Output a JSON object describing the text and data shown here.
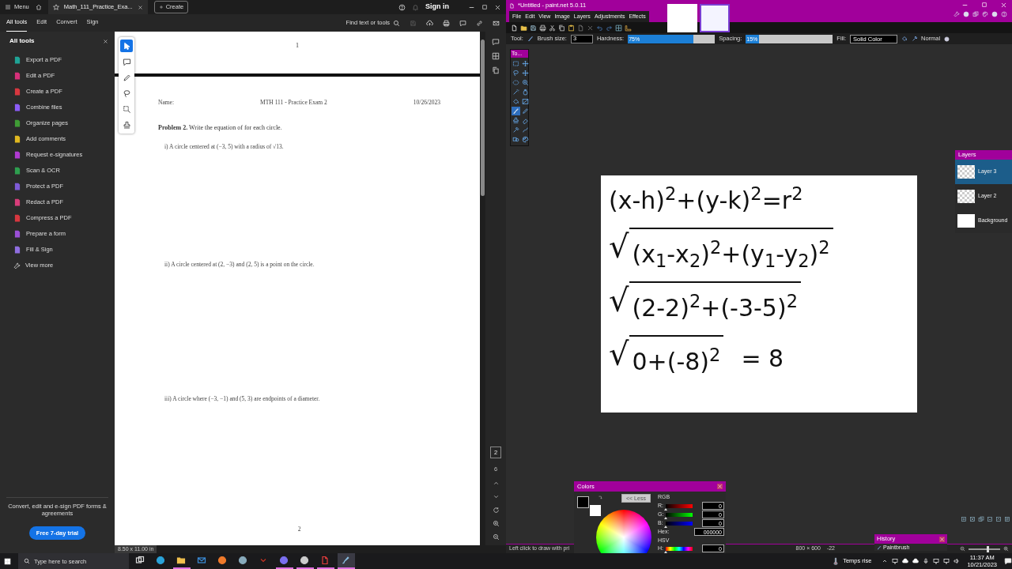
{
  "acrobat": {
    "title_bar": {
      "menu": "Menu",
      "tab_title": "Math_111_Practice_Exa...",
      "create": "Create",
      "sign_in": "Sign in"
    },
    "toolbar_tabs": [
      {
        "label": "All tools",
        "selected": true
      },
      {
        "label": "Edit",
        "selected": false
      },
      {
        "label": "Convert",
        "selected": false
      },
      {
        "label": "Sign",
        "selected": false
      }
    ],
    "find": "Find text or tools",
    "sidebar": {
      "title": "All tools",
      "items": [
        {
          "label": "Export a PDF",
          "kind": "tool",
          "color": "#1fa396"
        },
        {
          "label": "Edit a PDF",
          "kind": "tool",
          "color": "#d6307a"
        },
        {
          "label": "Create a PDF",
          "kind": "tool",
          "color": "#d7373f"
        },
        {
          "label": "Combine files",
          "kind": "tool",
          "color": "#8b5cf6"
        },
        {
          "label": "Organize pages",
          "kind": "tool",
          "color": "#3f9c35"
        },
        {
          "label": "Add comments",
          "kind": "tool",
          "color": "#e0b820"
        },
        {
          "label": "Request e-signatures",
          "kind": "tool",
          "color": "#b03ad1"
        },
        {
          "label": "Scan & OCR",
          "kind": "tool",
          "color": "#2e9e4f"
        },
        {
          "label": "Protect a PDF",
          "kind": "tool",
          "color": "#7e5bd6"
        },
        {
          "label": "Redact a PDF",
          "kind": "tool",
          "color": "#d83d7a"
        },
        {
          "label": "Compress a PDF",
          "kind": "tool",
          "color": "#d7373f"
        },
        {
          "label": "Prepare a form",
          "kind": "tool",
          "color": "#9a4fd6"
        },
        {
          "label": "Fill & Sign",
          "kind": "tool",
          "color": "#8f6ee0"
        },
        {
          "label": "View more",
          "kind": "more"
        }
      ],
      "promo": "Convert, edit and e-sign PDF forms & agreements",
      "trial_button": "Free 7-day trial"
    },
    "doc_tools": [
      {
        "selected": true
      },
      {
        "selected": false
      },
      {
        "selected": false
      },
      {
        "selected": false
      },
      {
        "selected": false
      },
      {
        "selected": false
      }
    ],
    "previous_page": {
      "number": "1"
    },
    "page": {
      "name": "Name:",
      "course": "MTH 111 - Practice Exam 2",
      "date": "10/26/2023",
      "problem": "**Problem 2.** Write the equation of for each circle.",
      "questions": [
        "i) A circle centered at (−3, 5) with a radius of √13.",
        "ii) A circle centered at (2, −3) and (2, 5) is a point on the circle.",
        "iii) A circle where (−3, −1) and (5, 3) are endpoints of a diameter."
      ],
      "number": "2"
    },
    "navigation": {
      "current_page": "2",
      "page_count": "6"
    },
    "page_size": "8.50 x 11.00 in"
  },
  "paintnet": {
    "title": "*Untitled - paint.net 5.0.11",
    "menu": [
      "File",
      "Edit",
      "View",
      "Image",
      "Layers",
      "Adjustments",
      "Effects"
    ],
    "images": [
      {
        "selected": false
      },
      {
        "selected": true
      }
    ],
    "options": {
      "tool_label": "Tool:",
      "brush_size_label": "Brush size:",
      "brush_size": "3",
      "hardness_label": "Hardness:",
      "hardness": {
        "reading": "75%",
        "level": 0.75
      },
      "spacing_label": "Spacing:",
      "spacing": {
        "reading": "15%",
        "level": 0.15
      },
      "fill_label": "Fill:",
      "fill": "Solid Color",
      "blend_mode": "Normal"
    },
    "tools_window": {
      "title": "To...",
      "tools": [
        {
          "selected": false
        },
        {
          "selected": false
        },
        {
          "selected": false
        },
        {
          "selected": false
        },
        {
          "selected": false
        },
        {
          "selected": false
        },
        {
          "selected": false
        },
        {
          "selected": false
        },
        {
          "selected": false
        },
        {
          "selected": false
        },
        {
          "selected": true
        },
        {
          "selected": false
        },
        {
          "selected": false
        },
        {
          "selected": false
        },
        {
          "selected": false
        },
        {
          "selected": false
        },
        {
          "selected": false
        },
        {
          "selected": false
        }
      ]
    },
    "canvas": {
      "lines": [
        {
          "expr": "(x-h)$^{2}$+(y-k)$^{2}$=r$^{2}$"
        },
        {
          "radical": "√",
          "expr": "(x$_{1}$-x$_{2}$)$^{2}$+(y$_{1}$-y$_{2}$)$^{2}$"
        },
        {
          "radical": "√",
          "expr": "(2-2)$^{2}$+(-3-5)$^{2}$"
        },
        {
          "radical": "√",
          "expr": "0+(-8)$^{2}$",
          "tail": "= 8"
        }
      ]
    },
    "layers": {
      "title": "Layers",
      "items": [
        {
          "name": "Layer 3",
          "selected": true,
          "kind": "transparent"
        },
        {
          "name": "Layer 2",
          "selected": false,
          "kind": "transparent"
        },
        {
          "name": "Background",
          "selected": false,
          "kind": "opaque"
        }
      ]
    },
    "colors": {
      "title": "Colors",
      "less_button": "<< Less",
      "rgb_label": "RGB",
      "channels": [
        {
          "label": "R:",
          "value": "0",
          "kind": "red",
          "level": 0
        },
        {
          "label": "G:",
          "value": "0",
          "kind": "green",
          "level": 0
        },
        {
          "label": "B:",
          "value": "0",
          "kind": "blue",
          "level": 0
        }
      ],
      "hex_label": "Hex:",
      "hex": "000000",
      "hsv_label": "HSV",
      "hue_label": "H:",
      "hue": "0",
      "hue_slider": {
        "level": 0
      }
    },
    "history": {
      "title": "History",
      "items": [
        "Paintbrush"
      ]
    },
    "status": {
      "hint": "Left click to draw with pri",
      "size": "800 × 600",
      "cursor": "-22",
      "zoom": {
        "level": 0.6
      }
    }
  },
  "taskbar": {
    "search_placeholder": "Type here to search",
    "apps": [
      {
        "running": false,
        "active": false
      },
      {
        "running": false,
        "active": false
      },
      {
        "running": true,
        "active": false
      },
      {
        "running": false,
        "active": false
      },
      {
        "running": false,
        "active": false
      },
      {
        "running": false,
        "active": false
      },
      {
        "running": false,
        "active": false
      },
      {
        "running": true,
        "active": false
      },
      {
        "running": true,
        "active": false
      },
      {
        "running": true,
        "active": false
      },
      {
        "running": true,
        "active": true
      }
    ],
    "weather": "Temps rise",
    "time": "11:37 AM",
    "date": "10/21/2023"
  }
}
